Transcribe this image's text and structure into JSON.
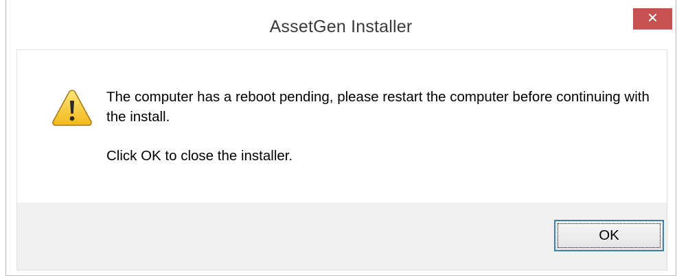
{
  "window": {
    "title": "AssetGen Installer",
    "close_glyph": "✕"
  },
  "message": {
    "line1": "The computer has a reboot pending, please restart the computer before continuing with the install.",
    "line2": "Click OK to close the installer."
  },
  "icon": {
    "name": "warning-icon",
    "colors": {
      "fill_top": "#ffe57a",
      "fill_bottom": "#f2b81a",
      "outline": "#a67b13",
      "mark": "#2b2b2b"
    }
  },
  "buttons": {
    "ok_label": "OK"
  },
  "colors": {
    "close_button": "#c75050",
    "footer": "#f0f0f0",
    "ok_border": "#3c7fb1"
  }
}
